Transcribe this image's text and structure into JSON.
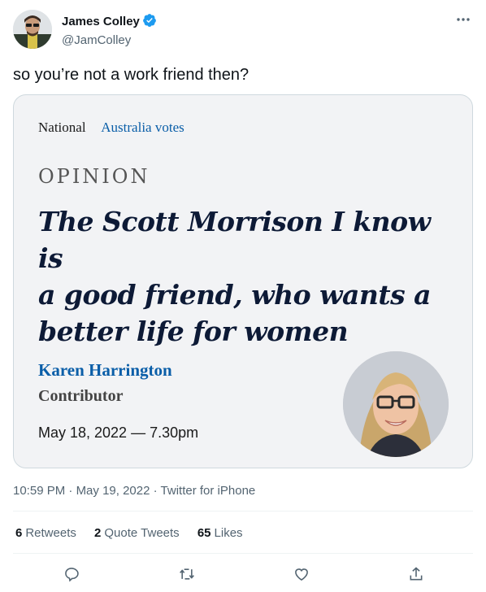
{
  "author": {
    "display_name": "James Colley",
    "handle": "@JamColley",
    "avatar_icon": "avatar-photo",
    "verified": true
  },
  "tweet": {
    "text": "so you’re not a work friend then?"
  },
  "card": {
    "nav_section": "National",
    "nav_subsection": "Australia votes",
    "kicker": "OPINION",
    "headline_lines": [
      "The Scott Morrison I know is",
      "a good friend, who wants a",
      "better life for women"
    ],
    "author_name": "Karen Harrington",
    "author_role": "Contributor",
    "date": "May 18, 2022 — 7.30pm"
  },
  "meta": {
    "time": "10:59 PM",
    "date": "May 19, 2022",
    "source": "Twitter for iPhone"
  },
  "stats": {
    "retweets_count": "6",
    "retweets_label": "Retweets",
    "quotes_count": "2",
    "quotes_label": "Quote Tweets",
    "likes_count": "65",
    "likes_label": "Likes"
  },
  "colors": {
    "verified": "#1d9bf0",
    "link_blue": "#0a5ea8",
    "headline_navy": "#0d1a36"
  }
}
